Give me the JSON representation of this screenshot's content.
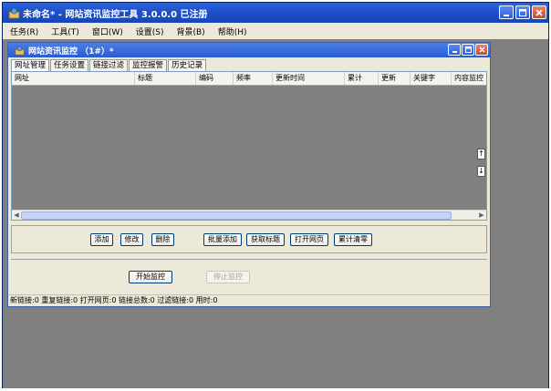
{
  "app": {
    "title": "未命名* - 网站资讯监控工具 3.0.0.0  已注册",
    "menu": [
      "任务(R)",
      "工具(T)",
      "窗口(W)",
      "设置(S)",
      "背景(B)",
      "帮助(H)"
    ]
  },
  "child": {
    "title": "网站资讯监控  （1#）*",
    "tabs": [
      "网址管理",
      "任务设置",
      "链接过滤",
      "监控报警",
      "历史记录"
    ],
    "columns": [
      "网址",
      "标题",
      "编码",
      "频率",
      "更新时间",
      "累计",
      "更新",
      "关键字",
      "内容监控"
    ],
    "side_up": "↑",
    "side_down": "↓",
    "buttons": {
      "add": "添加",
      "edit": "修改",
      "delete": "删除",
      "batch_add": "批量添加",
      "get_title": "获取标题",
      "open_page": "打开网页",
      "clear_count": "累计清零",
      "start": "开始监控",
      "stop": "停止监控"
    },
    "status": "新链接:0 重复链接:0 打开网页:0 链接总数:0 过滤链接:0 用时:0"
  }
}
